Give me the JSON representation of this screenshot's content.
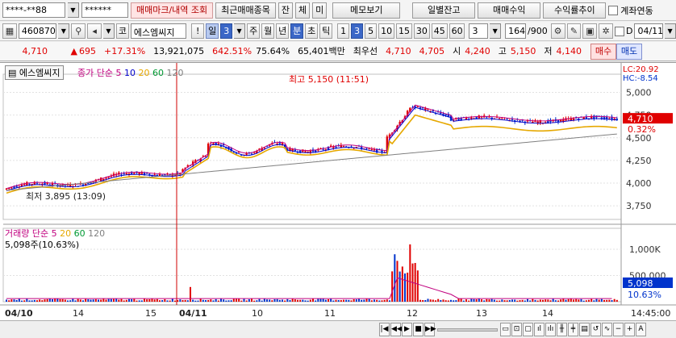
{
  "toolbar1": {
    "account": "****-**88",
    "password": "******",
    "buttons": [
      "매매마크/내역 조회",
      "최근매매종목",
      "잔",
      "체",
      "미",
      "메모보기",
      "일별잔고",
      "매매수익",
      "수익률추이"
    ],
    "account_link_label": "계좌연동"
  },
  "toolbar2": {
    "code": "460870",
    "market": "코",
    "name": "에스엠씨지",
    "excl": "!",
    "period_label": "일",
    "period_value": "3",
    "periods": [
      "주",
      "월",
      "년",
      "분",
      "초",
      "틱"
    ],
    "intervals": [
      "1",
      "3",
      "5",
      "10",
      "15",
      "30",
      "45",
      "60"
    ],
    "interval_value": "3",
    "count": "164",
    "count_total": "/900",
    "date": "04/11"
  },
  "quote": {
    "price": "4,710",
    "change": "695",
    "change_pct": "+17.31%",
    "volume": "13,921,075",
    "vol_ratio": "642.51%",
    "turnover_ratio": "75.64%",
    "amount": "65,401백만",
    "best_label": "최우선",
    "ask": "4,710",
    "bid": "4,705",
    "open_label": "시",
    "open": "4,240",
    "high_label": "고",
    "high": "5,150",
    "low_label": "저",
    "low": "4,140",
    "buy": "매수",
    "sell": "매도"
  },
  "chart": {
    "stock_tab": "에스엠씨지",
    "legend_prefix": "종가 단순",
    "ma_periods": [
      "5",
      "10",
      "20",
      "60",
      "120"
    ],
    "colors": {
      "ma5": "#c0007f",
      "ma10": "#0000cc",
      "ma20": "#e6a800",
      "ma60": "#009933",
      "ma120": "#808080",
      "up": "#e00000",
      "down": "#0033cc"
    },
    "lc": "LC:20.92",
    "hc": "HC:-8.54",
    "price_ticks": [
      "5,000",
      "4,750",
      "4,500",
      "4,250",
      "4,000",
      "3,750"
    ],
    "current_price": "4,710",
    "current_pct": "0.32%",
    "high_note": "최고 5,150 (11:51)",
    "low_note": "최저 3,895 (13:09)",
    "vol_legend_label": "거래량",
    "vol_legend_prefix": "단순",
    "vol_periods": [
      "5",
      "20",
      "60",
      "120"
    ],
    "vol_info": "5,098주(10.63%)",
    "vol_ticks": [
      "1,000K",
      "500,000"
    ],
    "vol_current": "5,098",
    "vol_pct": "10.63%",
    "x_labels": [
      "04/10",
      "14",
      "15",
      "04/11",
      "10",
      "11",
      "12",
      "13",
      "14"
    ],
    "time_label": "14:45:00"
  },
  "bottom": {
    "icons": [
      "prev-icon",
      "play-icon",
      "stop-icon",
      "pause-icon",
      "next-icon"
    ]
  }
}
